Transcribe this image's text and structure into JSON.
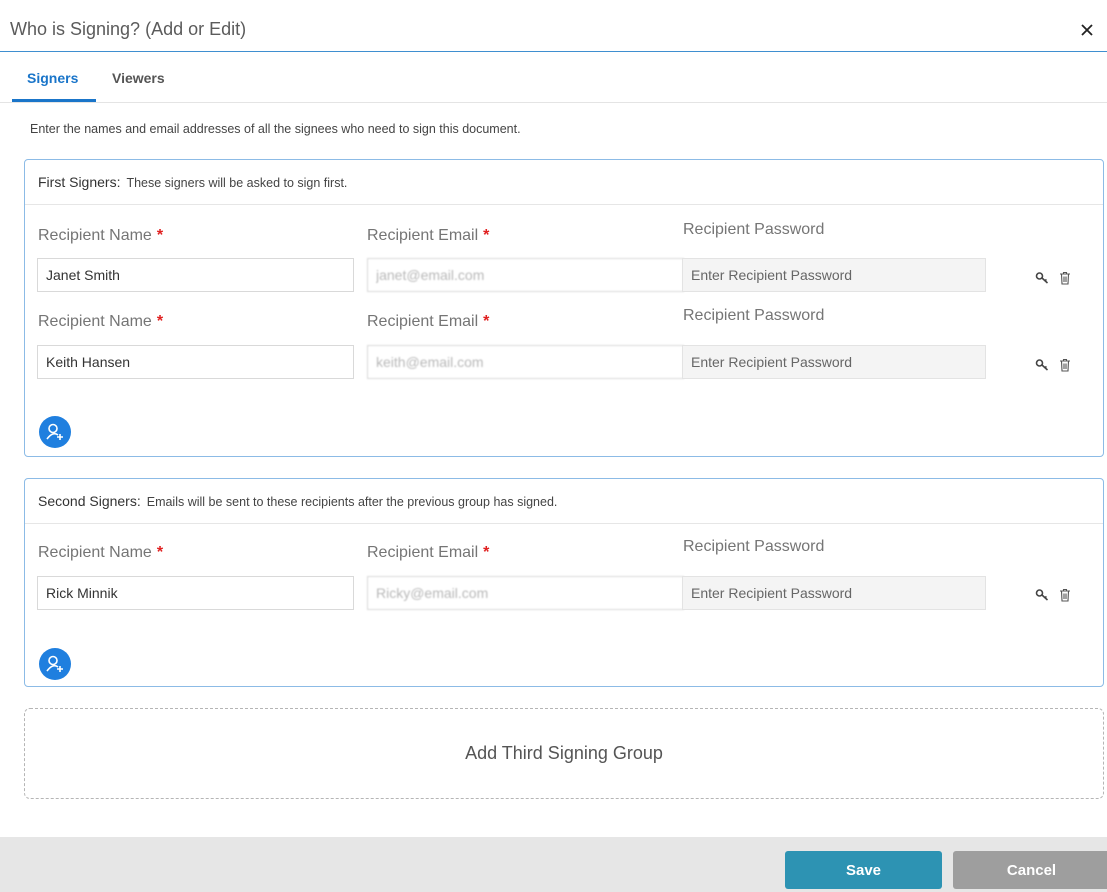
{
  "dialog": {
    "title": "Who is Signing? (Add or Edit)",
    "close_label": "×"
  },
  "tabs": [
    {
      "label": "Signers",
      "active": true
    },
    {
      "label": "Viewers",
      "active": false
    }
  ],
  "intro": "Enter the names and email addresses of all the signees who need to sign this document.",
  "labels": {
    "name": "Recipient Name",
    "email": "Recipient Email",
    "password": "Recipient Password",
    "required_mark": "*",
    "password_placeholder": "Enter Recipient Password"
  },
  "groups": [
    {
      "title": "First Signers:",
      "description": "These signers will be asked to sign first.",
      "recipients": [
        {
          "name": "Janet Smith",
          "email": "janet@email.com"
        },
        {
          "name": "Keith Hansen",
          "email": "keith@email.com"
        }
      ]
    },
    {
      "title": "Second Signers:",
      "description": "Emails will be sent to these recipients after the previous group has signed.",
      "recipients": [
        {
          "name": "Rick Minnik",
          "email": "Ricky@email.com"
        }
      ]
    }
  ],
  "add_group_label": "Add Third Signing Group",
  "footer": {
    "save_label": "Save",
    "cancel_label": "Cancel"
  },
  "colors": {
    "accent": "#1a75c9",
    "add_button": "#1f7fdf",
    "save": "#2d93b3",
    "cancel": "#9e9e9e",
    "required": "#e02020"
  },
  "icons": [
    "close-icon",
    "key-icon",
    "trash-icon",
    "add-user-icon"
  ]
}
